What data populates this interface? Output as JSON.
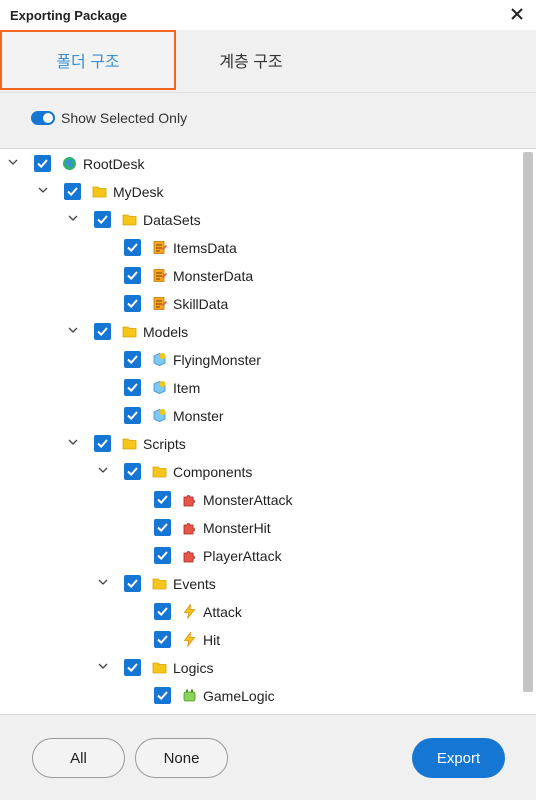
{
  "window": {
    "title": "Exporting Package"
  },
  "tabs": [
    {
      "label": "폴더 구조",
      "active": true
    },
    {
      "label": "계층 구조",
      "active": false
    }
  ],
  "options": {
    "show_selected_only_label": "Show Selected Only",
    "show_selected_only": true
  },
  "tree": [
    {
      "label": "RootDesk",
      "type": "root",
      "checked": true
    },
    {
      "label": "MyDesk",
      "type": "folder",
      "checked": true
    },
    {
      "label": "DataSets",
      "type": "folder",
      "checked": true
    },
    {
      "label": "ItemsData",
      "type": "data",
      "checked": true
    },
    {
      "label": "MonsterData",
      "type": "data",
      "checked": true
    },
    {
      "label": "SkillData",
      "type": "data",
      "checked": true
    },
    {
      "label": "Models",
      "type": "folder",
      "checked": true
    },
    {
      "label": "FlyingMonster",
      "type": "model",
      "checked": true
    },
    {
      "label": "Item",
      "type": "model",
      "checked": true
    },
    {
      "label": "Monster",
      "type": "model",
      "checked": true
    },
    {
      "label": "Scripts",
      "type": "folder",
      "checked": true
    },
    {
      "label": "Components",
      "type": "folder",
      "checked": true
    },
    {
      "label": "MonsterAttack",
      "type": "component",
      "checked": true
    },
    {
      "label": "MonsterHit",
      "type": "component",
      "checked": true
    },
    {
      "label": "PlayerAttack",
      "type": "component",
      "checked": true
    },
    {
      "label": "Events",
      "type": "folder",
      "checked": true
    },
    {
      "label": "Attack",
      "type": "event",
      "checked": true
    },
    {
      "label": "Hit",
      "type": "event",
      "checked": true
    },
    {
      "label": "Logics",
      "type": "folder",
      "checked": true
    },
    {
      "label": "GameLogic",
      "type": "logic",
      "checked": true
    },
    {
      "label": "",
      "type": "partial",
      "checked": true
    }
  ],
  "footer": {
    "all_label": "All",
    "none_label": "None",
    "export_label": "Export"
  },
  "colors": {
    "accent": "#1577d3",
    "active_tab_border": "#f26522",
    "active_tab_text": "#3a8fd6"
  }
}
